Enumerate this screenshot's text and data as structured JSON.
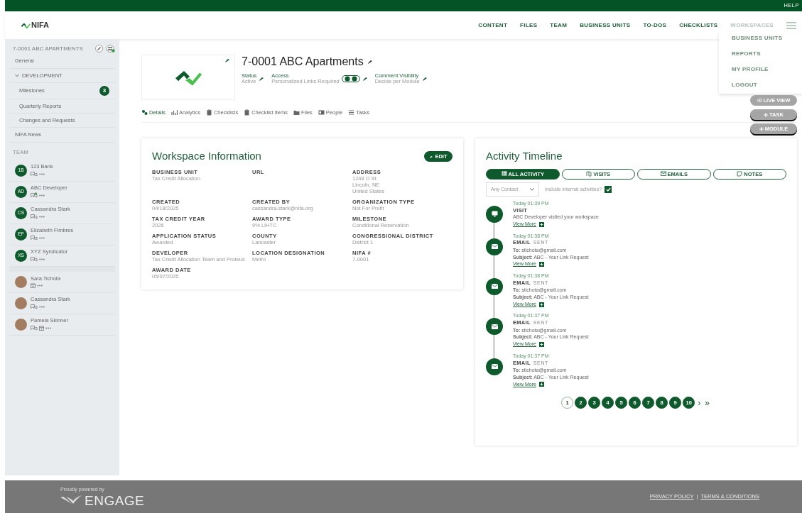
{
  "top_bar": {
    "help": "HELP"
  },
  "header": {
    "logo": "NIFA",
    "nav": [
      {
        "label": "CONTENT",
        "dimmed": false
      },
      {
        "label": "FILES",
        "dimmed": false
      },
      {
        "label": "TEAM",
        "dimmed": false
      },
      {
        "label": "BUSINESS UNITS",
        "dimmed": false
      },
      {
        "label": "TO-DOS",
        "dimmed": false
      },
      {
        "label": "CHECKLISTS",
        "dimmed": false
      },
      {
        "label": "WORKSPACES",
        "dimmed": true
      }
    ]
  },
  "menu": {
    "items": [
      "BUSINESS UNITS",
      "REPORTS",
      "MY PROFILE",
      "LOGOUT"
    ]
  },
  "float_buttons": [
    {
      "label": "LIVE VIEW",
      "kind": "view"
    },
    {
      "label": "TASK",
      "kind": "add"
    },
    {
      "label": "MODULE",
      "kind": "add"
    }
  ],
  "sidebar": {
    "title": "7-0001 ABC APARTMENTS",
    "items": [
      {
        "label": "General"
      },
      {
        "label": "DEVELOPMENT",
        "expanded": true,
        "children": [
          {
            "label": "Milestones",
            "badge": "3"
          },
          {
            "label": "Quarterly Reports"
          },
          {
            "label": "Changes and Requests"
          }
        ]
      },
      {
        "label": "NIFA News"
      }
    ],
    "team_label": "TEAM",
    "team": [
      {
        "kind": "org",
        "initials": "1B",
        "name": "123 Bank",
        "chat": true,
        "new_message": false,
        "calendar": false
      },
      {
        "kind": "org",
        "initials": "AD",
        "name": "ABC Developer",
        "chat": true,
        "new_message": true,
        "calendar": false
      },
      {
        "kind": "org",
        "initials": "CS",
        "name": "Cassandra Stark",
        "chat": true,
        "new_message": false,
        "calendar": false
      },
      {
        "kind": "org",
        "initials": "EF",
        "name": "Elizabeth Fimbres",
        "chat": true,
        "new_message": false,
        "calendar": false
      },
      {
        "kind": "org",
        "initials": "XS",
        "name": "XYZ Syndicator",
        "chat": true,
        "new_message": false,
        "calendar": false
      },
      {
        "kind": "person",
        "name": "Sara Tichota",
        "chat": false,
        "calendar": true
      },
      {
        "kind": "person",
        "name": "Cassandra Stark",
        "chat": true,
        "new_message": false,
        "calendar": false
      },
      {
        "kind": "person",
        "name": "Pamela Skinner",
        "chat": true,
        "new_message": false,
        "calendar": true
      }
    ]
  },
  "workspace": {
    "title": "7-0001 ABC Apartments",
    "meta": [
      {
        "kind": "status",
        "label": "Status",
        "value": "Active"
      },
      {
        "kind": "access",
        "label": "Access",
        "value": "Personalized Links Required"
      },
      {
        "kind": "comments",
        "label": "Comment Visibility",
        "value": "Decide per Module"
      }
    ],
    "tabs": [
      {
        "label": "Details",
        "kind": "gears",
        "selected": true
      },
      {
        "label": "Analytics",
        "kind": "chart",
        "selected": false
      },
      {
        "label": "Checklists",
        "kind": "clipboard",
        "selected": false
      },
      {
        "label": "Checklist Items",
        "kind": "clipboard",
        "selected": false
      },
      {
        "label": "Files",
        "kind": "folder",
        "selected": false
      },
      {
        "label": "People",
        "kind": "card",
        "selected": false
      },
      {
        "label": "Tasks",
        "kind": "list",
        "selected": false
      }
    ]
  },
  "info_card": {
    "title": "Workspace Information",
    "edit": "EDIT",
    "fields": [
      {
        "label": "BUSINESS UNIT",
        "value": [
          "Tax Credit Allocation"
        ]
      },
      {
        "label": "URL"
      },
      {
        "label": "ADDRESS",
        "value": [
          "1248 O St",
          "Lincoln, NE",
          "United States"
        ]
      },
      {
        "label": "CREATED",
        "value": [
          "04/18/2025"
        ]
      },
      {
        "label": "CREATED BY",
        "value": [
          "cassandra.stark@nifa.org"
        ]
      },
      {
        "label": "ORGANIZATION TYPE",
        "value": [
          "Not For Profit"
        ]
      },
      {
        "label": "TAX CREDIT YEAR",
        "value": [
          "2026"
        ]
      },
      {
        "label": "AWARD TYPE",
        "value": [
          "9% LIHTC"
        ]
      },
      {
        "label": "MILESTONE",
        "value": [
          "Conditional Reservation"
        ]
      },
      {
        "label": "APPLICATION STATUS",
        "value": [
          "Awarded"
        ]
      },
      {
        "label": "COUNTY",
        "value": [
          "Lancaster"
        ]
      },
      {
        "label": "CONGRESSIONAL DISTRICT",
        "value": [
          "District 1"
        ]
      },
      {
        "label": "DEVELOPER",
        "value": [
          "Tax Credit Allocation Team and Proteus"
        ]
      },
      {
        "label": "LOCATION DESIGNATION",
        "value": [
          "Metro"
        ]
      },
      {
        "label": "NIFA #",
        "value": [
          "7-0001"
        ]
      },
      {
        "label": "AWARD DATE",
        "value": [
          "05/07/2025"
        ]
      }
    ]
  },
  "timeline": {
    "title": "Activity Timeline",
    "filters": [
      {
        "label": "ALL ACTIVITY",
        "kind": "all",
        "selected": true
      },
      {
        "label": "VISITS",
        "kind": "visit",
        "selected": false
      },
      {
        "label": "EMAILS",
        "kind": "email",
        "selected": false
      },
      {
        "label": "NOTES",
        "kind": "note",
        "selected": false
      }
    ],
    "contact_select": "Any Contact",
    "include_internal": {
      "label": "Include internal activities?",
      "checked": true
    },
    "entries": [
      {
        "kind": "visit",
        "time": "Today 01:39 PM",
        "type": "VISIT",
        "lines": [
          "ABC Developer visited your workspace"
        ],
        "link": "View More"
      },
      {
        "kind": "email",
        "time": "Today 01:38 PM",
        "type": "EMAIL",
        "status": "SENT",
        "lines": [
          "**To:** stichota@gmail.com",
          "**Subject:** ABC - Your Link Request"
        ],
        "link": "View More"
      },
      {
        "kind": "email",
        "time": "Today 01:38 PM",
        "type": "EMAIL",
        "status": "SENT",
        "lines": [
          "**To:** stichota@gmail.com",
          "**Subject:** ABC - Your Link Request"
        ],
        "link": "View More"
      },
      {
        "kind": "email",
        "time": "Today 01:37 PM",
        "type": "EMAIL",
        "status": "SENT",
        "lines": [
          "**To:** stichota@gmail.com",
          "**Subject:** ABC - Your Link Request"
        ],
        "link": "View More"
      },
      {
        "kind": "email",
        "time": "Today 01:37 PM",
        "type": "EMAIL",
        "status": "SENT",
        "lines": [
          "**To:** stichota@gmail.com",
          "**Subject:** ABC - Your Link Request"
        ],
        "link": "View More"
      }
    ],
    "pages": [
      {
        "label": "1",
        "selected": true
      },
      {
        "label": "2",
        "selected": false
      },
      {
        "label": "3",
        "selected": false
      },
      {
        "label": "4",
        "selected": false
      },
      {
        "label": "5",
        "selected": false
      },
      {
        "label": "6",
        "selected": false
      },
      {
        "label": "7",
        "selected": false
      },
      {
        "label": "8",
        "selected": false
      },
      {
        "label": "9",
        "selected": false
      },
      {
        "label": "10",
        "selected": false
      }
    ],
    "next": "›",
    "last": "»"
  },
  "footer": {
    "powered_by": "Proudly powered by",
    "brand": "ENGAGE",
    "links": [
      "PRIVACY POLICY",
      "TERMS & CONDITIONS"
    ],
    "separator": "|"
  }
}
